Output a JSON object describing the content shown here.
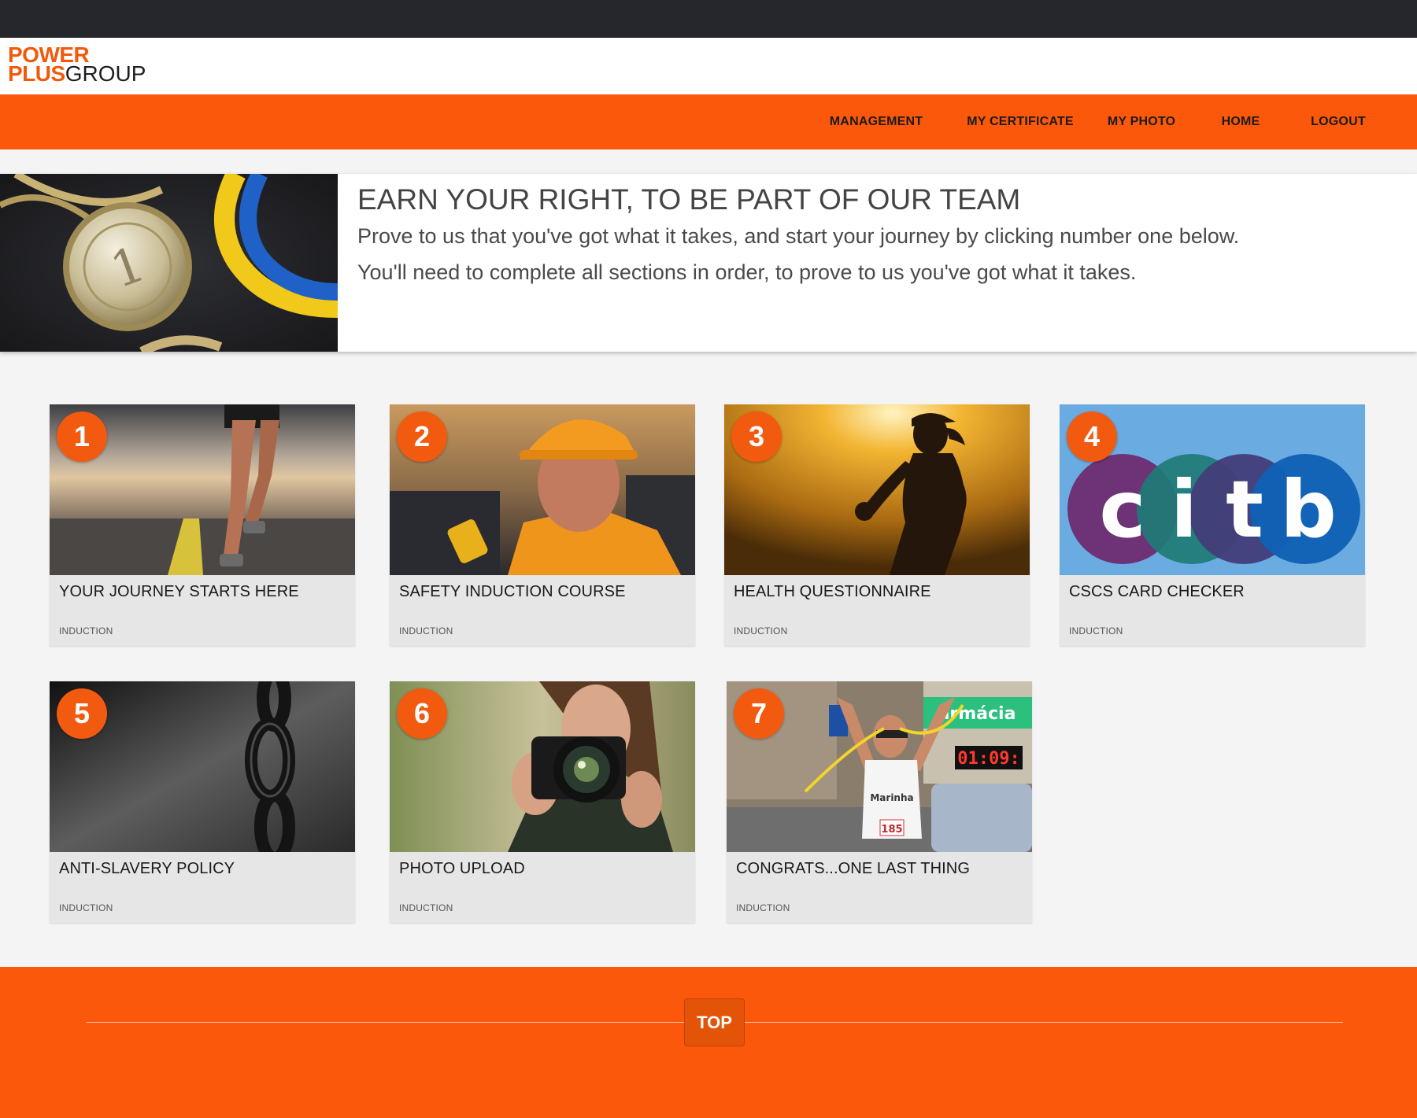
{
  "brand": {
    "line1": "POWER",
    "line2_accent": "PLUS",
    "line2_rest": "GROUP",
    "accent_color": "#fb580c"
  },
  "nav": {
    "items": [
      {
        "label": "MANAGEMENT"
      },
      {
        "label": "MY CERTIFICATE"
      },
      {
        "label": "MY PHOTO"
      },
      {
        "label": "HOME"
      },
      {
        "label": "LOGOUT"
      }
    ]
  },
  "hero": {
    "image": "gold-medal-ribbon-image",
    "title": "EARN YOUR RIGHT, TO BE PART OF OUR TEAM",
    "line1": "Prove to us that you've got what it takes, and start your journey by clicking number one below.",
    "line2": "You'll need to complete all sections in order, to prove to us you've got what it takes."
  },
  "cards": [
    {
      "number": "1",
      "title": "YOUR JOURNEY STARTS HERE",
      "tag": "INDUCTION",
      "image": "runner-on-road-image"
    },
    {
      "number": "2",
      "title": "SAFETY INDUCTION COURSE",
      "tag": "INDUCTION",
      "image": "construction-worker-radio-image"
    },
    {
      "number": "3",
      "title": "HEALTH QUESTIONNAIRE",
      "tag": "INDUCTION",
      "image": "woman-running-sunset-image"
    },
    {
      "number": "4",
      "title": "CSCS CARD CHECKER",
      "tag": "INDUCTION",
      "image": "citb-logo-image",
      "logo_letters": [
        "c",
        "i",
        "t",
        "b"
      ]
    },
    {
      "number": "5",
      "title": "ANTI-SLAVERY POLICY",
      "tag": "INDUCTION",
      "image": "chain-image"
    },
    {
      "number": "6",
      "title": "PHOTO UPLOAD",
      "tag": "INDUCTION",
      "image": "woman-with-camera-image"
    },
    {
      "number": "7",
      "title": "CONGRATS...ONE LAST THING",
      "tag": "INDUCTION",
      "image": "marathon-finish-image",
      "sign_text": "armácia",
      "clock_text": "01:09:",
      "bib_text": "185",
      "shirt_text": "Marinha"
    }
  ],
  "footer": {
    "top_label": "TOP"
  }
}
